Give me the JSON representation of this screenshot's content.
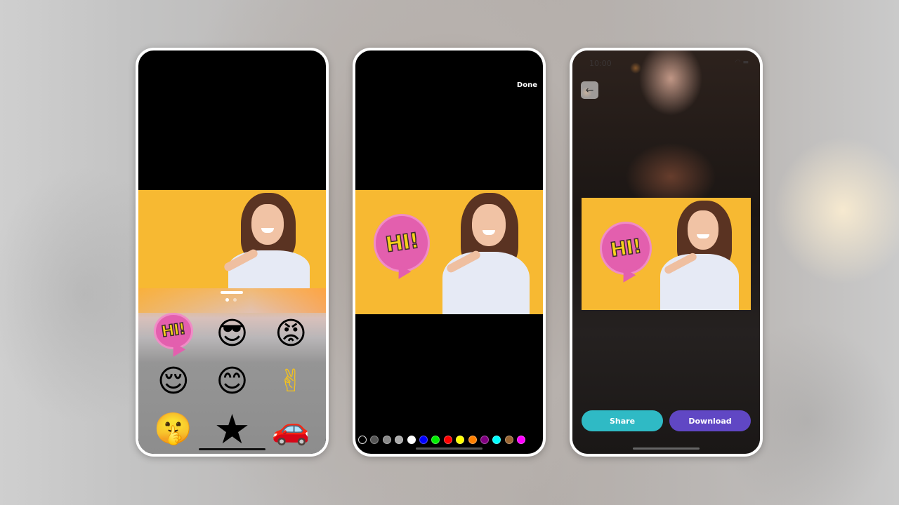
{
  "background": {
    "description": "blurred woman portrait backdrop"
  },
  "screens": [
    {
      "name": "sticker-picker",
      "photo": {
        "subject": "smiling woman pointing on yellow background"
      },
      "pager": {
        "pages": 2,
        "current": 1
      },
      "stickers": [
        {
          "name": "hi-speech-bubble",
          "glyph": "HI!"
        },
        {
          "name": "cool-boy-sunglasses",
          "glyph": "😎"
        },
        {
          "name": "angry-phone-emoji",
          "glyph": "😡"
        },
        {
          "name": "sleepy-pointing-emoji",
          "glyph": "😌"
        },
        {
          "name": "thumbs-down-emoji",
          "glyph": "😊"
        },
        {
          "name": "peace-sign-emoji",
          "glyph": "✌"
        },
        {
          "name": "shush-emoji",
          "glyph": "🤫"
        },
        {
          "name": "star-skull-emblem",
          "glyph": "★"
        },
        {
          "name": "cartoon-car",
          "glyph": "🚗"
        }
      ]
    },
    {
      "name": "color-editor",
      "done_label": "Done",
      "sticker_text": "HI!",
      "palette": [
        "#000000",
        "#555555",
        "#888888",
        "#aaaaaa",
        "#ffffff",
        "#0000ff",
        "#00ee00",
        "#ff0000",
        "#ffff00",
        "#ff8000",
        "#800080",
        "#00ffff",
        "#996633",
        "#ff00ff"
      ],
      "selected_color_index": 0
    },
    {
      "name": "result",
      "status_time": "10:00",
      "back_icon": "←",
      "sticker_text": "HI!",
      "share_label": "Share",
      "download_label": "Download",
      "colors": {
        "share": "#2fbac5",
        "download": "#6047c4"
      }
    }
  ]
}
